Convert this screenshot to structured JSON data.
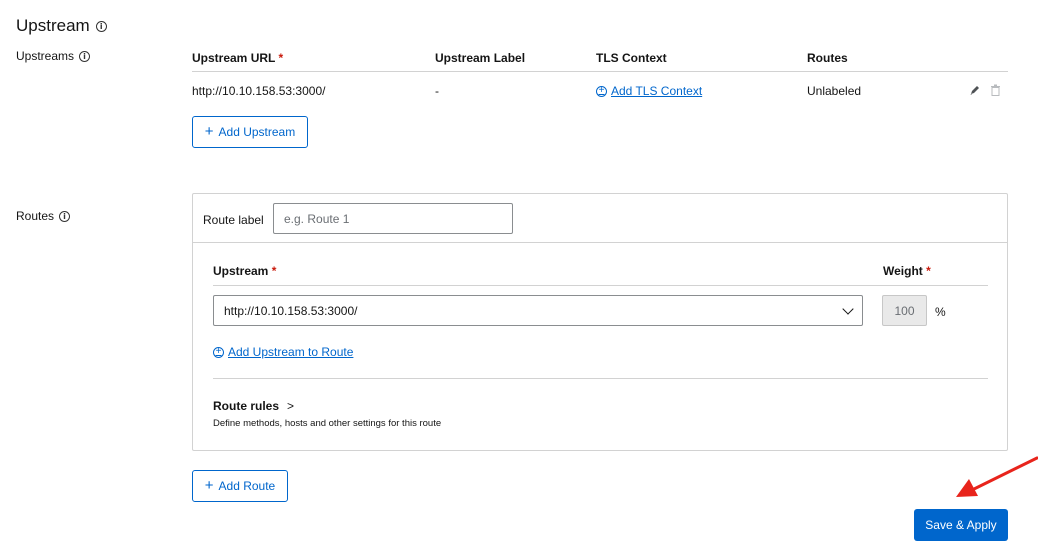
{
  "section": {
    "title": "Upstream"
  },
  "upstreams": {
    "label": "Upstreams",
    "columns": {
      "url": "Upstream URL",
      "label": "Upstream Label",
      "tls": "TLS Context",
      "routes": "Routes"
    },
    "required_mark": "*",
    "rows": [
      {
        "url": "http://10.10.158.53:3000/",
        "label": "-",
        "tls_action": "Add TLS Context",
        "routes": "Unlabeled"
      }
    ],
    "add_button": "Add Upstream"
  },
  "routes": {
    "label": "Routes",
    "route_label_caption": "Route label",
    "route_label_placeholder": "e.g. Route 1",
    "upstream_header": "Upstream",
    "weight_header": "Weight",
    "required_mark": "*",
    "upstream_value": "http://10.10.158.53:3000/",
    "weight_value": "100",
    "weight_unit": "%",
    "add_upstream_to_route": "Add Upstream to Route",
    "rules_title": "Route rules",
    "rules_chevron": ">",
    "rules_description": "Define methods, hosts and other settings for this route",
    "add_button": "Add Route"
  },
  "footer": {
    "save_button": "Save & Apply"
  },
  "colors": {
    "accent": "#0066cc",
    "required": "#c9190b",
    "arrow": "#e8241c"
  },
  "icons": [
    "info-icon",
    "edit-icon",
    "trash-icon",
    "plus-circle-icon",
    "plus-icon",
    "chevron-down-icon",
    "red-arrow"
  ]
}
